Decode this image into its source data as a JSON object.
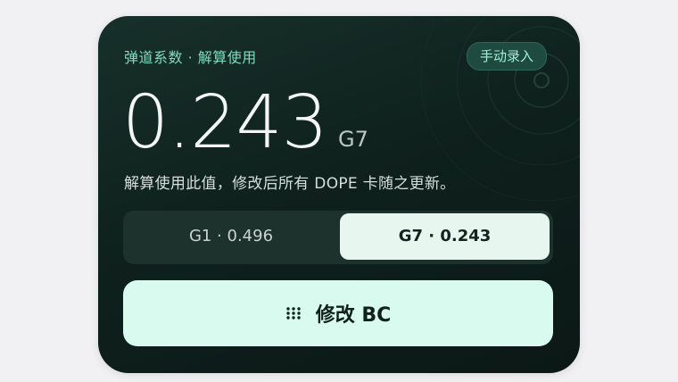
{
  "card": {
    "eyebrow": "弹道系数 · 解算使用",
    "manual_entry_label": "手动录入",
    "bc_value": "0.243",
    "bc_model": "G7",
    "hint": "解算使用此值，修改后所有 DOPE 卡随之更新。",
    "segments": [
      {
        "label": "G1 · 0.496",
        "selected": false
      },
      {
        "label": "G7 · 0.243",
        "selected": true
      }
    ],
    "edit_button_label": "修改 BC",
    "edit_button_icon": "grid-dots-icon"
  },
  "colors": {
    "accent": "#7fdcbe",
    "card_bg": "#0f211d",
    "selected_segment": "#e7f6ef",
    "primary_button": "#d9fbef"
  }
}
